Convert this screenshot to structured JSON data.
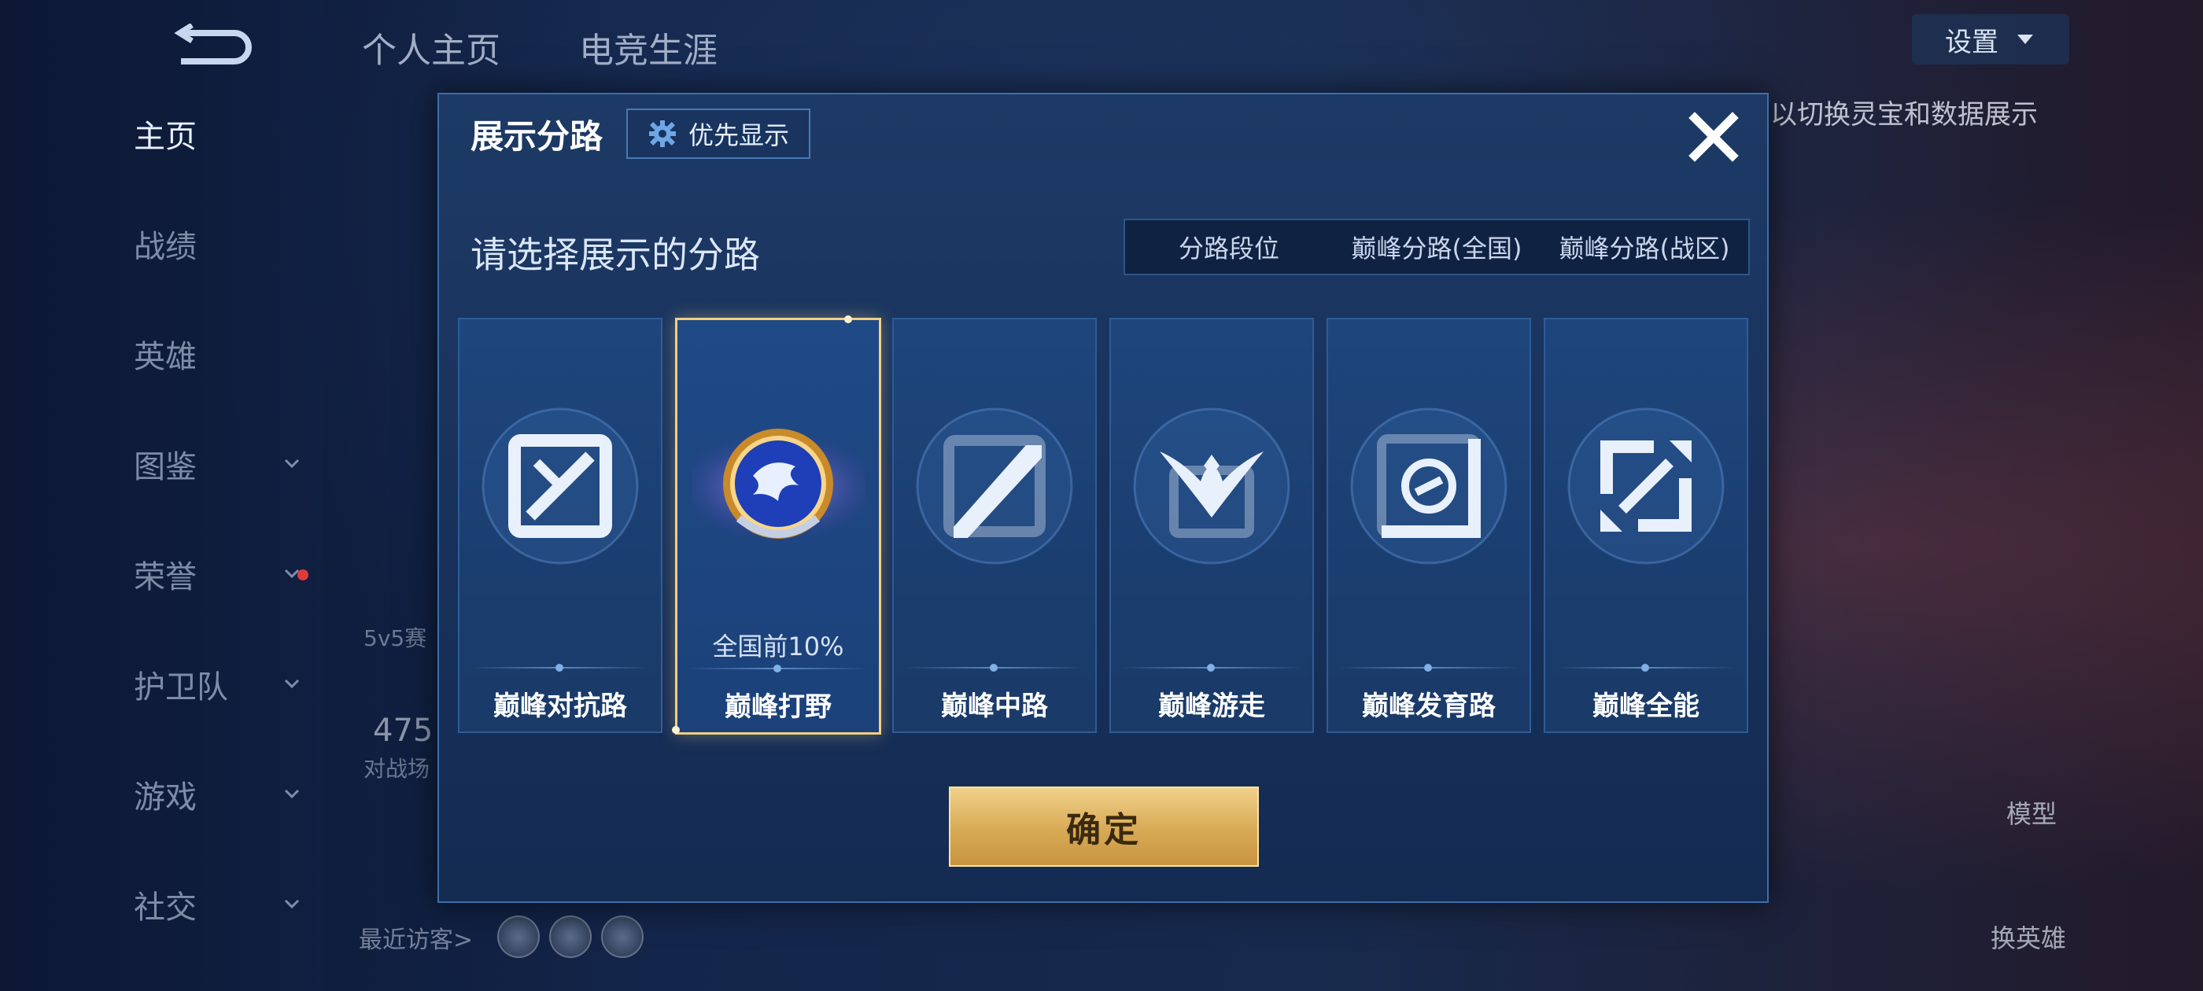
{
  "sidebar": {
    "items": [
      {
        "label": "主页",
        "active": true,
        "chevron": false
      },
      {
        "label": "战绩",
        "active": false,
        "chevron": false
      },
      {
        "label": "英雄",
        "active": false,
        "chevron": false
      },
      {
        "label": "图鉴",
        "active": false,
        "chevron": true
      },
      {
        "label": "荣誉",
        "active": false,
        "chevron": true
      },
      {
        "label": "护卫队",
        "active": false,
        "chevron": true
      },
      {
        "label": "游戏",
        "active": false,
        "chevron": true
      },
      {
        "label": "社交",
        "active": false,
        "chevron": true
      }
    ]
  },
  "top_tabs": [
    "个人主页",
    "电竞生涯"
  ],
  "background": {
    "settings_label": "设置",
    "switch_text": "以切换灵宝和数据展示",
    "recent_visitors": "最近访客>",
    "count_value": "475",
    "count_label": "对战场",
    "mode_label": "5v5赛",
    "model_label": "模型",
    "switch_hero_label": "换英雄"
  },
  "modal": {
    "title": "展示分路",
    "priority_label": "优先显示",
    "prompt": "请选择展示的分路",
    "segments": [
      {
        "label": "分路段位",
        "active": false
      },
      {
        "label": "巅峰分路(全国)",
        "active": true
      },
      {
        "label": "巅峰分路(战区)",
        "active": false
      }
    ],
    "roles": [
      {
        "name": "巅峰对抗路",
        "icon": "clash-lane-icon",
        "selected": false,
        "rank": ""
      },
      {
        "name": "巅峰打野",
        "icon": "jungle-dragon-icon",
        "selected": true,
        "rank": "全国前10%"
      },
      {
        "name": "巅峰中路",
        "icon": "mid-lane-icon",
        "selected": false,
        "rank": ""
      },
      {
        "name": "巅峰游走",
        "icon": "roam-wings-icon",
        "selected": false,
        "rank": ""
      },
      {
        "name": "巅峰发育路",
        "icon": "farm-lane-icon",
        "selected": false,
        "rank": ""
      },
      {
        "name": "巅峰全能",
        "icon": "all-round-icon",
        "selected": false,
        "rank": ""
      }
    ],
    "confirm_label": "确定"
  },
  "colors": {
    "accent_blue": "#2a6cc0",
    "gold": "#d8aa56",
    "selected_border": "#f2cf82"
  }
}
